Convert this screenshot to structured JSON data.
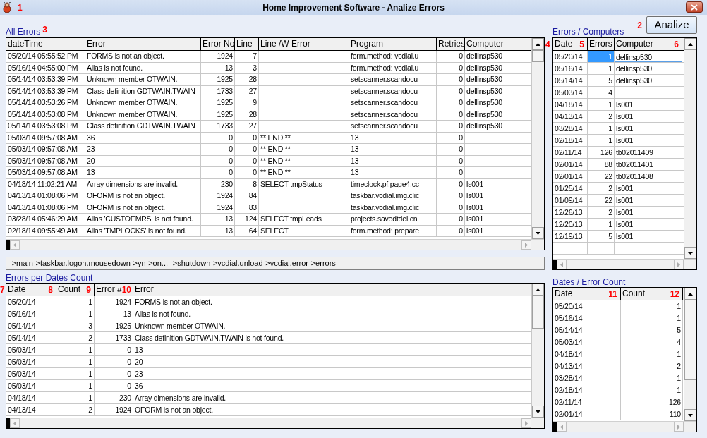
{
  "window": {
    "title": "Home Improvement Software - Analize Errors",
    "callout": "1"
  },
  "analyze_button": {
    "label": "Analize",
    "callout": "2"
  },
  "all_errors": {
    "title": "All Errors",
    "callout": "3",
    "columns": [
      {
        "label": "dateTime"
      },
      {
        "label": "Error"
      },
      {
        "label": "Error No"
      },
      {
        "label": "Line"
      },
      {
        "label": "Line /W Error"
      },
      {
        "label": "Program"
      },
      {
        "label": "Retries"
      },
      {
        "label": "Computer"
      }
    ],
    "rows": [
      {
        "cells": [
          "05/20/14 05:55:52 PM",
          "FORMS is not an object.",
          "1924",
          "7",
          "",
          "form.method: vcdial.u",
          "0",
          "dellinsp530"
        ]
      },
      {
        "cells": [
          "05/16/14 04:55:00 PM",
          "Alias is not found.",
          "13",
          "3",
          "",
          "form.method: vcdial.u",
          "0",
          "dellinsp530"
        ]
      },
      {
        "cells": [
          "05/14/14 03:53:39 PM",
          "Unknown member OTWAIN.",
          "1925",
          "28",
          "",
          "setscanner.scandocu",
          "0",
          "dellinsp530"
        ]
      },
      {
        "cells": [
          "05/14/14 03:53:39 PM",
          "Class definition GDTWAIN.TWAIN",
          "1733",
          "27",
          "",
          "setscanner.scandocu",
          "0",
          "dellinsp530"
        ]
      },
      {
        "cells": [
          "05/14/14 03:53:26 PM",
          "Unknown member OTWAIN.",
          "1925",
          "9",
          "",
          "setscanner.scandocu",
          "0",
          "dellinsp530"
        ]
      },
      {
        "cells": [
          "05/14/14 03:53:08 PM",
          "Unknown member OTWAIN.",
          "1925",
          "28",
          "",
          "setscanner.scandocu",
          "0",
          "dellinsp530"
        ]
      },
      {
        "cells": [
          "05/14/14 03:53:08 PM",
          "Class definition GDTWAIN.TWAIN",
          "1733",
          "27",
          "",
          "setscanner.scandocu",
          "0",
          "dellinsp530"
        ]
      },
      {
        "cells": [
          "05/03/14 09:57:08 AM",
          "36",
          "0",
          "0",
          "** END **",
          "13",
          "0",
          ""
        ]
      },
      {
        "cells": [
          "05/03/14 09:57:08 AM",
          "23",
          "0",
          "0",
          "** END **",
          "13",
          "0",
          ""
        ]
      },
      {
        "cells": [
          "05/03/14 09:57:08 AM",
          "20",
          "0",
          "0",
          "** END **",
          "13",
          "0",
          ""
        ]
      },
      {
        "cells": [
          "05/03/14 09:57:08 AM",
          "13",
          "0",
          "0",
          "** END **",
          "13",
          "0",
          ""
        ]
      },
      {
        "cells": [
          "04/18/14 11:02:21 AM",
          "Array dimensions are invalid.",
          "230",
          "8",
          "SELECT tmpStatus",
          "timeclock.pf.page4.cc",
          "0",
          "ls001"
        ]
      },
      {
        "cells": [
          "04/13/14 01:08:06 PM",
          "OFORM is not an object.",
          "1924",
          "84",
          "",
          "taskbar.vcdial.img.clic",
          "0",
          "ls001"
        ]
      },
      {
        "cells": [
          "04/13/14 01:08:06 PM",
          "OFORM is not an object.",
          "1924",
          "83",
          "",
          "taskbar.vcdial.img.clic",
          "0",
          "ls001"
        ]
      },
      {
        "cells": [
          "03/28/14 05:46:29 AM",
          "Alias 'CUSTOEMRS' is not found.",
          "13",
          "124",
          "SELECT tmpLeads",
          "projects.savedtdel.cn",
          "0",
          "ls001"
        ]
      },
      {
        "cells": [
          "02/18/14 09:55:49 AM",
          "Alias 'TMPLOCKS' is not found.",
          "13",
          "64",
          "SELECT",
          "form.method: prepare",
          "0",
          "ls001"
        ]
      }
    ]
  },
  "errors_computers": {
    "title": "Errors / Computers",
    "callout": "4",
    "columns": [
      {
        "label": "Date",
        "callout": "5"
      },
      {
        "label": "Errors"
      },
      {
        "label": "Computer",
        "callout": "6"
      }
    ],
    "rows": [
      {
        "cells": [
          "05/20/14",
          "1",
          "dellinsp530"
        ],
        "selected": true
      },
      {
        "cells": [
          "05/16/14",
          "1",
          "dellinsp530"
        ],
        "selected": false
      },
      {
        "cells": [
          "05/14/14",
          "5",
          "dellinsp530"
        ],
        "selected": false
      },
      {
        "cells": [
          "05/03/14",
          "4",
          ""
        ],
        "selected": false
      },
      {
        "cells": [
          "04/18/14",
          "1",
          "ls001"
        ],
        "selected": false
      },
      {
        "cells": [
          "04/13/14",
          "2",
          "ls001"
        ],
        "selected": false
      },
      {
        "cells": [
          "03/28/14",
          "1",
          "ls001"
        ],
        "selected": false
      },
      {
        "cells": [
          "02/18/14",
          "1",
          "ls001"
        ],
        "selected": false
      },
      {
        "cells": [
          "02/11/14",
          "126",
          "tb02011409"
        ],
        "selected": false
      },
      {
        "cells": [
          "02/01/14",
          "88",
          "tb02011401"
        ],
        "selected": false
      },
      {
        "cells": [
          "02/01/14",
          "22",
          "tb02011408"
        ],
        "selected": false
      },
      {
        "cells": [
          "01/25/14",
          "2",
          "ls001"
        ],
        "selected": false
      },
      {
        "cells": [
          "01/09/14",
          "22",
          "ls001"
        ],
        "selected": false
      },
      {
        "cells": [
          "12/26/13",
          "2",
          "ls001"
        ],
        "selected": false
      },
      {
        "cells": [
          "12/20/13",
          "1",
          "ls001"
        ],
        "selected": false
      },
      {
        "cells": [
          "12/19/13",
          "5",
          "ls001"
        ],
        "selected": false
      }
    ]
  },
  "call_path": "->main->taskbar.logon.mousedown->yn->on... ->shutdown->vcdial.unload->vcdial.error->errors",
  "errors_per_dates": {
    "title": "Errors per Dates Count",
    "callout": "7",
    "columns": [
      {
        "label": "Date",
        "callout": "8"
      },
      {
        "label": "Count",
        "callout": "9"
      },
      {
        "label": "Error #",
        "callout": "10"
      },
      {
        "label": "Error"
      }
    ],
    "rows": [
      {
        "cells": [
          "05/20/14",
          "1",
          "1924",
          "FORMS is not an object."
        ]
      },
      {
        "cells": [
          "05/16/14",
          "1",
          "13",
          "Alias is not found."
        ]
      },
      {
        "cells": [
          "05/14/14",
          "3",
          "1925",
          "Unknown member OTWAIN."
        ]
      },
      {
        "cells": [
          "05/14/14",
          "2",
          "1733",
          "Class definition GDTWAIN.TWAIN is not found."
        ]
      },
      {
        "cells": [
          "05/03/14",
          "1",
          "0",
          "13"
        ]
      },
      {
        "cells": [
          "05/03/14",
          "1",
          "0",
          "20"
        ]
      },
      {
        "cells": [
          "05/03/14",
          "1",
          "0",
          "23"
        ]
      },
      {
        "cells": [
          "05/03/14",
          "1",
          "0",
          "36"
        ]
      },
      {
        "cells": [
          "04/18/14",
          "1",
          "230",
          "Array dimensions are invalid."
        ]
      },
      {
        "cells": [
          "04/13/14",
          "2",
          "1924",
          "OFORM is not an object."
        ]
      }
    ]
  },
  "dates_error_count": {
    "title": "Dates / Error Count",
    "columns": [
      {
        "label": "Date",
        "callout": "11"
      },
      {
        "label": "Count",
        "callout": "12"
      }
    ],
    "rows": [
      {
        "cells": [
          "05/20/14",
          "1"
        ]
      },
      {
        "cells": [
          "05/16/14",
          "1"
        ]
      },
      {
        "cells": [
          "05/14/14",
          "5"
        ]
      },
      {
        "cells": [
          "05/03/14",
          "4"
        ]
      },
      {
        "cells": [
          "04/18/14",
          "1"
        ]
      },
      {
        "cells": [
          "04/13/14",
          "2"
        ]
      },
      {
        "cells": [
          "03/28/14",
          "1"
        ]
      },
      {
        "cells": [
          "02/18/14",
          "1"
        ]
      },
      {
        "cells": [
          "02/11/14",
          "126"
        ]
      },
      {
        "cells": [
          "02/01/14",
          "110"
        ]
      }
    ]
  }
}
